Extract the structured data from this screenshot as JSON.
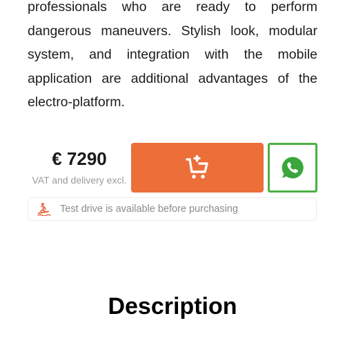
{
  "product": {
    "description_tail": "professionals who are ready to perform dangerous maneuvers. Stylish look, modular system, and integration with the mobile application are additional advantages of the electro-platform."
  },
  "pricing": {
    "price": "€ 7290",
    "note": "VAT and delivery excl."
  },
  "actions": {
    "cart_icon": "add-to-cart-icon",
    "whatsapp_icon": "whatsapp-icon"
  },
  "test_drive": {
    "icon": "surfer-icon",
    "label": "Test drive is available before purchasing"
  },
  "sections": {
    "description_heading": "Description"
  },
  "colors": {
    "accent": "#ec6e39",
    "whatsapp": "#4caf43",
    "test_drive_icon": "#e8643a",
    "muted_text": "#9a9a9a"
  }
}
